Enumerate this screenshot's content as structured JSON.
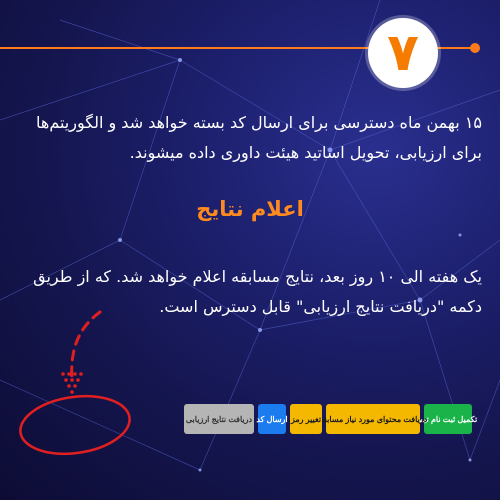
{
  "step_number": "۷",
  "intro_text": "۱۵ بهمن ماه دسترسی برای ارسال کد بسته خواهد شد و الگوریتم‌ها برای ارزیابی، تحویل اساتید هیئت داوری داده میشوند.",
  "section_title": "اعلام نتایج",
  "results_text": "یک هفته الی ۱۰ روز بعد، نتایج مسابقه اعلام خواهد شد. که از طریق دکمه \"دریافت نتایج ارزیابی\" قابل دسترس است.",
  "buttons": {
    "complete_registration": "تکمیل ثبت نام تیم",
    "get_content": "دریافت محتوای مورد نیاز مسابقه",
    "change_password": "تغییر رمز",
    "send_code": "ارسال کد",
    "get_results": "دریافت نتایج ارزیابی"
  },
  "colors": {
    "accent": "#ff7a1a",
    "highlight_circle": "#e02020"
  }
}
